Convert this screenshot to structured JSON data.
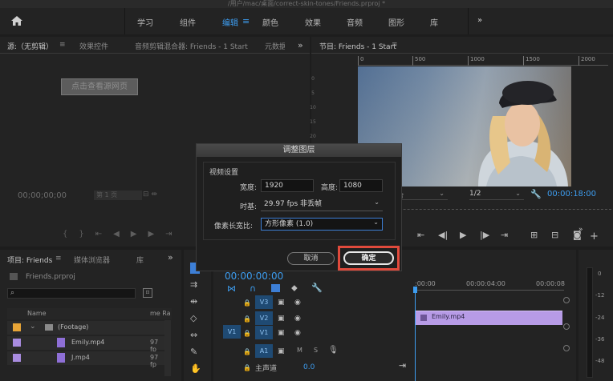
{
  "window": {
    "title": "/用户/mac/桌面/correct-skin-tones/Friends.prproj *"
  },
  "workspaces": {
    "home_icon": "home-icon",
    "items": [
      "学习",
      "组件",
      "编辑",
      "颜色",
      "效果",
      "音频",
      "图形",
      "库"
    ],
    "active": "编辑",
    "more": "»"
  },
  "source_panel": {
    "tabs": [
      "源:（无剪辑）",
      "效果控件",
      "音频剪辑混合器: Friends - 1 Start",
      "元数据"
    ],
    "watermark": "点击查看源网页",
    "timecode": "00;00;00;00",
    "page": "第 1 页"
  },
  "program_panel": {
    "title": "节目: Friends - 1 Start",
    "ruler": [
      "0",
      "500",
      "1000",
      "1500",
      "2000"
    ],
    "fit": "合",
    "zoom": "1/2",
    "timecode": "00:00:18:00"
  },
  "project_panel": {
    "tabs": [
      "项目: Friends",
      "媒体浏览器",
      "库"
    ],
    "file": "Friends.prproj",
    "columns": [
      "Name",
      "me Ra"
    ],
    "items": [
      {
        "name": "(Footage)",
        "rate": ""
      },
      {
        "name": "Emily.mp4",
        "rate": "97 fp"
      },
      {
        "name": "J.mp4",
        "rate": "97 fp"
      }
    ]
  },
  "timeline": {
    "timecode": "00:00:00:00",
    "ruler": [
      ":00:00",
      "00:00:04:00",
      "00:00:08"
    ],
    "tracks": [
      "V3",
      "V2",
      "V1",
      "A1"
    ],
    "source_patch": "V1",
    "master": "主声道",
    "master_value": "0.0",
    "clip": "Emily.mp4",
    "track_buttons": [
      "M",
      "S"
    ]
  },
  "meter": {
    "ticks": [
      "0",
      "-12",
      "-24",
      "-36",
      "-48"
    ]
  },
  "dialog": {
    "title": "调整图层",
    "section": "视频设置",
    "width_label": "宽度:",
    "width_value": "1920",
    "height_label": "高度:",
    "height_value": "1080",
    "timebase_label": "时基:",
    "timebase_value": "29.97 fps 非丢帧",
    "par_label": "像素长宽比:",
    "par_value": "方形像素 (1.0)",
    "cancel": "取消",
    "ok": "确定",
    "highlight_color": "#e04a3c"
  }
}
